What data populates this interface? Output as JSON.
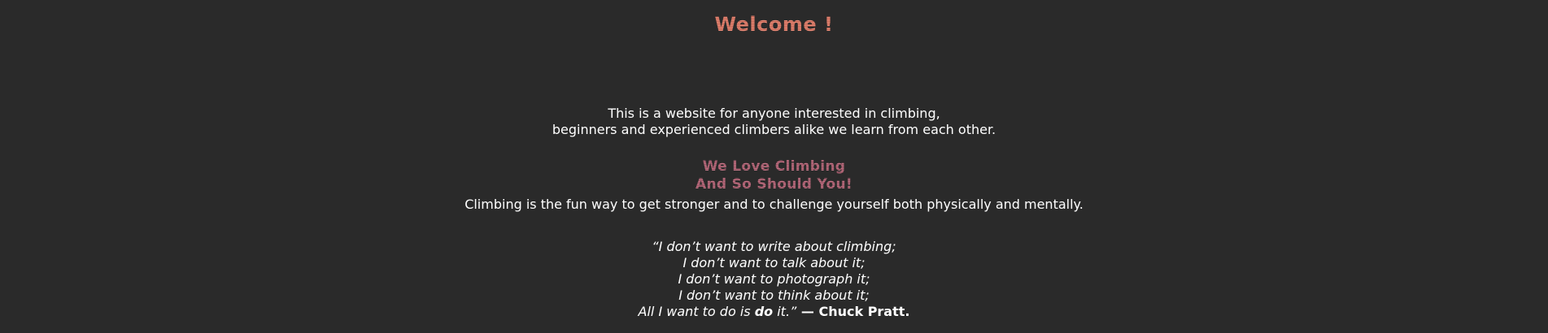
{
  "header": {
    "title": "Welcome !"
  },
  "intro": {
    "line1": "This is a website for anyone interested in climbing,",
    "line2": "beginners and experienced climbers alike we learn from each other."
  },
  "slogan": {
    "line1": "We Love Climbing",
    "line2": "And So Should You!"
  },
  "pitch": {
    "text": "Climbing is the fun way to get stronger and to challenge yourself both physically and mentally."
  },
  "quote": {
    "line1": "“I don’t want to write about climbing;",
    "line2": "I don’t want to talk about it;",
    "line3": "I don’t want to photograph it;",
    "line4": "I don’t want to think about it;",
    "line5_before": "All I want to do is ",
    "line5_emph": "do",
    "line5_after": " it.”",
    "author": " — Chuck Pratt."
  },
  "colors": {
    "background": "#2a2a2a",
    "title": "#e0806e",
    "slogan": "#b96a7a",
    "text": "#ffffff"
  }
}
